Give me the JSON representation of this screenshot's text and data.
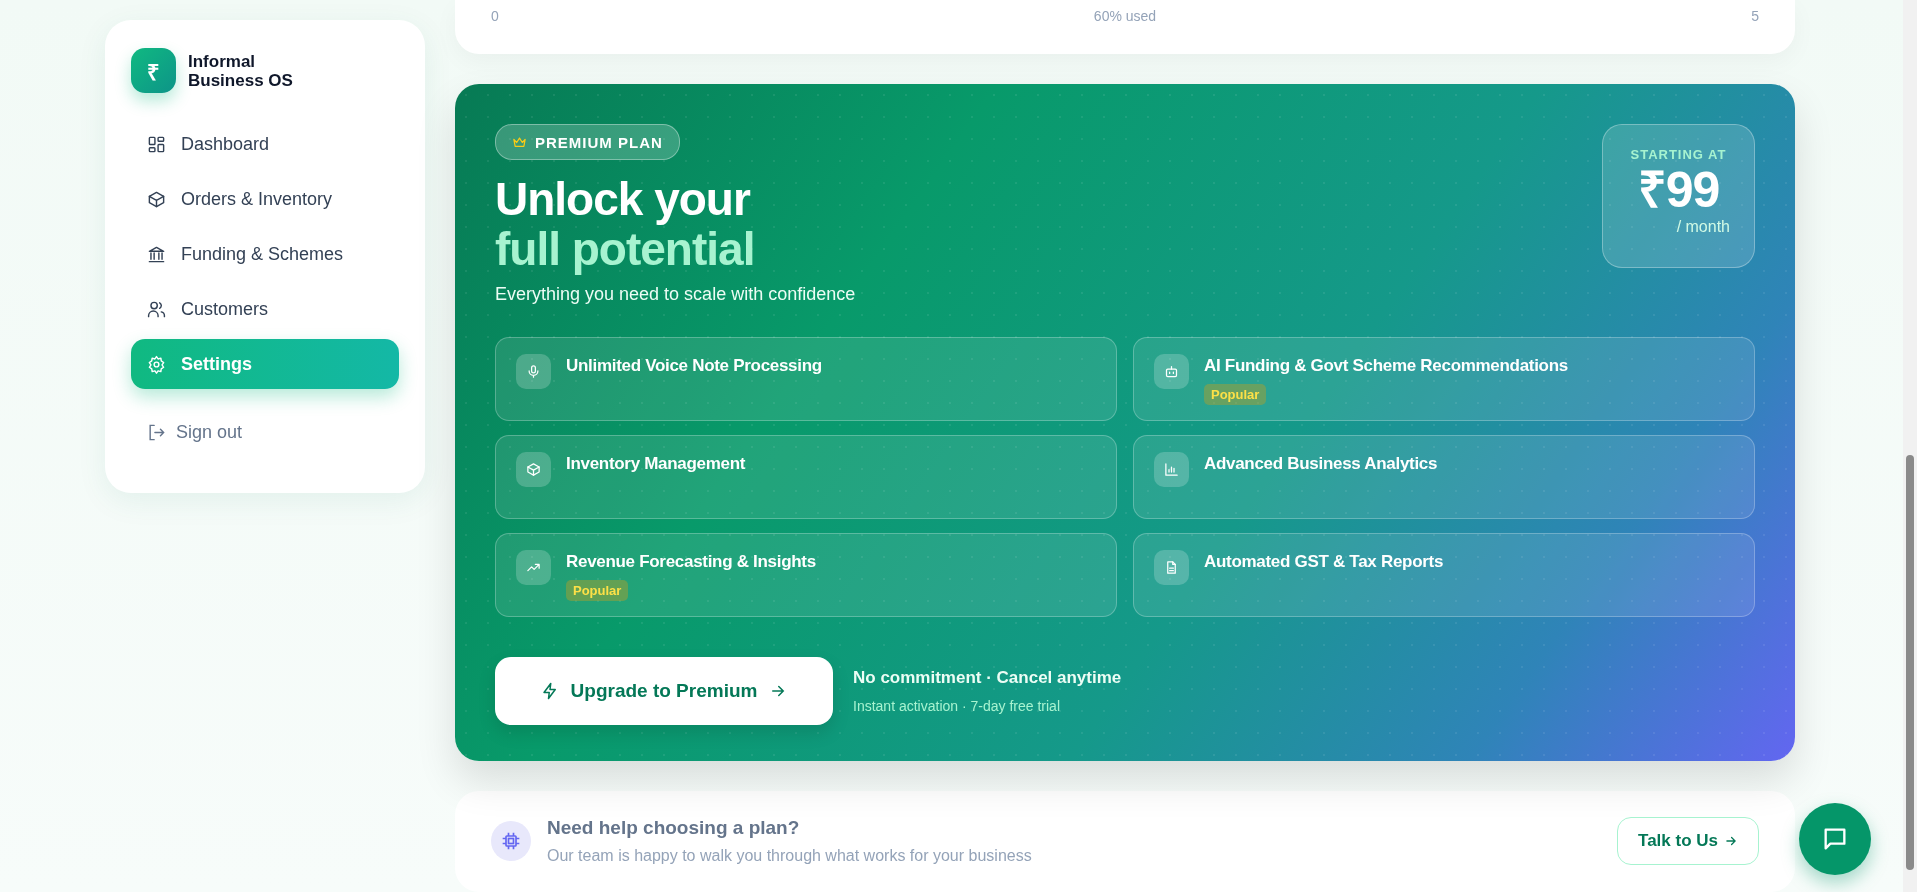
{
  "sidebar": {
    "logo_mark": "₹",
    "brand": [
      "Informal",
      "Business OS"
    ],
    "items": [
      {
        "label": "Dashboard",
        "selected": false
      },
      {
        "label": "Orders & Inventory",
        "selected": false
      },
      {
        "label": "Funding & Schemes",
        "selected": false
      },
      {
        "label": "Customers",
        "selected": false
      },
      {
        "label": "Settings",
        "selected": true
      }
    ],
    "sign_out": "Sign out"
  },
  "usage_card": {
    "scale_min": "0",
    "caption": "60% used",
    "scale_max": "5"
  },
  "premium": {
    "badge": "PREMIUM PLAN",
    "title": "Unlock your",
    "title_highlight": "full potential",
    "subtitle": "Everything you need to scale with confidence",
    "price": {
      "label": "STARTING AT",
      "amount": "₹99",
      "period": "/ month"
    },
    "features": [
      {
        "title": "Unlimited Voice Note Processing"
      },
      {
        "title": "AI Funding & Govt Scheme Recommendations",
        "badge": "Popular"
      },
      {
        "title": "Inventory Management"
      },
      {
        "title": "Advanced Business Analytics"
      },
      {
        "title": "Revenue Forecasting & Insights",
        "badge": "Popular"
      },
      {
        "title": "Automated GST & Tax Reports"
      }
    ],
    "cta": "Upgrade to Premium",
    "note": "No commitment · Cancel anytime",
    "subnote": "Instant activation · 7-day free trial"
  },
  "help": {
    "title": "Need help choosing a plan?",
    "subtitle": "Our team is happy to walk you through what works for your business",
    "button": "Talk to Us"
  }
}
